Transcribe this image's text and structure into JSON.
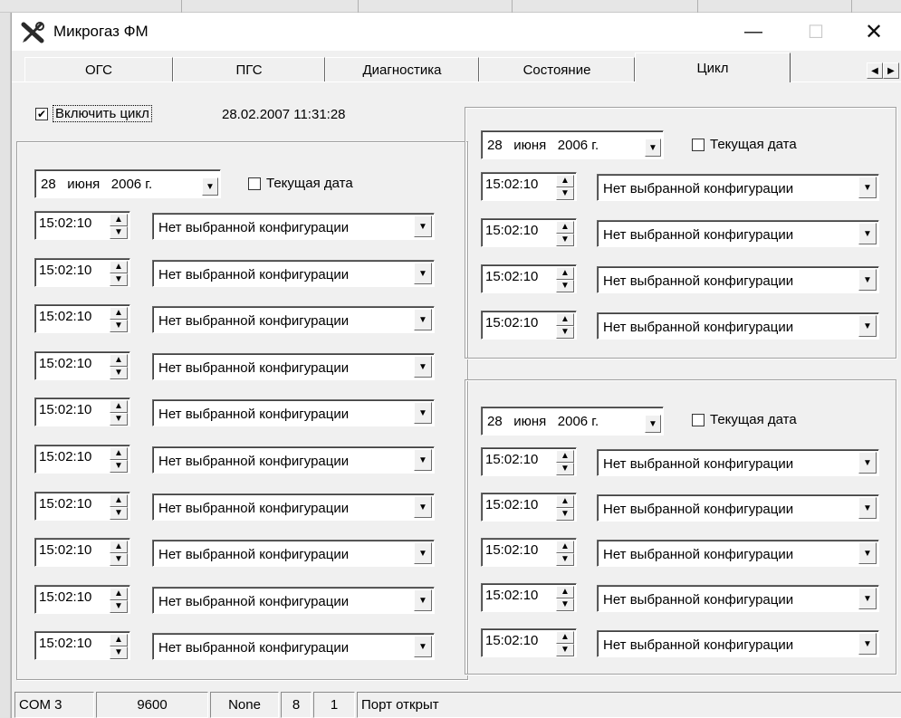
{
  "window": {
    "title": "Микрогаз ФМ",
    "controls": {
      "minimize": "—",
      "maximize": "☐",
      "close": "✕"
    }
  },
  "tabs": [
    {
      "label": "ОГС",
      "active": false
    },
    {
      "label": "ПГС",
      "active": false
    },
    {
      "label": "Диагностика",
      "active": false
    },
    {
      "label": "Состояние",
      "active": false
    },
    {
      "label": "Цикл",
      "active": true
    }
  ],
  "tab_scroll": {
    "left": "◀",
    "right": "▶"
  },
  "cycle": {
    "enable_label": "Включить цикл",
    "enabled": true,
    "timestamp": "28.02.2007 11:31:28"
  },
  "groups": [
    {
      "date": {
        "day": "28",
        "month": "июня",
        "year": "2006 г."
      },
      "current_date_label": "Текущая дата",
      "current_date_checked": false,
      "rows": [
        {
          "time": "15:02:10",
          "config": "Нет выбранной конфигурации"
        },
        {
          "time": "15:02:10",
          "config": "Нет выбранной конфигурации"
        },
        {
          "time": "15:02:10",
          "config": "Нет выбранной конфигурации"
        },
        {
          "time": "15:02:10",
          "config": "Нет выбранной конфигурации"
        },
        {
          "time": "15:02:10",
          "config": "Нет выбранной конфигурации"
        },
        {
          "time": "15:02:10",
          "config": "Нет выбранной конфигурации"
        },
        {
          "time": "15:02:10",
          "config": "Нет выбранной конфигурации"
        },
        {
          "time": "15:02:10",
          "config": "Нет выбранной конфигурации"
        },
        {
          "time": "15:02:10",
          "config": "Нет выбранной конфигурации"
        },
        {
          "time": "15:02:10",
          "config": "Нет выбранной конфигурации"
        }
      ]
    },
    {
      "date": {
        "day": "28",
        "month": "июня",
        "year": "2006 г."
      },
      "current_date_label": "Текущая дата",
      "current_date_checked": false,
      "rows": [
        {
          "time": "15:02:10",
          "config": "Нет выбранной конфигурации"
        },
        {
          "time": "15:02:10",
          "config": "Нет выбранной конфигурации"
        },
        {
          "time": "15:02:10",
          "config": "Нет выбранной конфигурации"
        },
        {
          "time": "15:02:10",
          "config": "Нет выбранной конфигурации"
        }
      ]
    },
    {
      "date": {
        "day": "28",
        "month": "июня",
        "year": "2006 г."
      },
      "current_date_label": "Текущая дата",
      "current_date_checked": false,
      "rows": [
        {
          "time": "15:02:10",
          "config": "Нет выбранной конфигурации"
        },
        {
          "time": "15:02:10",
          "config": "Нет выбранной конфигурации"
        },
        {
          "time": "15:02:10",
          "config": "Нет выбранной конфигурации"
        },
        {
          "time": "15:02:10",
          "config": "Нет выбранной конфигурации"
        },
        {
          "time": "15:02:10",
          "config": "Нет выбранной конфигурации"
        }
      ]
    }
  ],
  "icons": {
    "spin_up": "▲",
    "spin_down": "▼",
    "dropdown": "▼",
    "check": "✔",
    "app": "tools-icon"
  },
  "status": {
    "port": "COM 3",
    "baud": "9600",
    "parity": "None",
    "data_bits": "8",
    "stop_bits": "1",
    "state": "Порт открыт"
  }
}
